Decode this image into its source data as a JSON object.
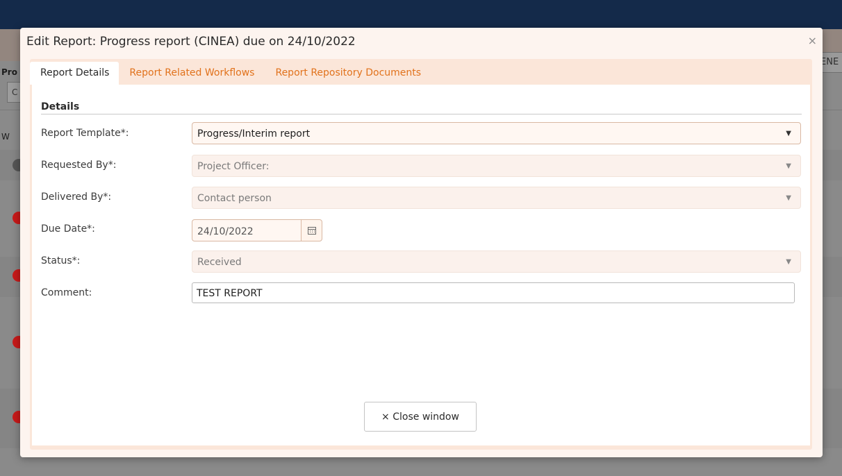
{
  "background": {
    "header_button_fragment": "ENE",
    "left_label_1": "Pro",
    "left_box_char": "C",
    "left_label_2": "W"
  },
  "modal": {
    "title": "Edit Report: Progress report (CINEA) due on 24/10/2022",
    "close_icon": "×"
  },
  "tabs": [
    {
      "label": "Report Details",
      "active": true
    },
    {
      "label": "Report Related Workflows",
      "active": false
    },
    {
      "label": "Report Repository Documents",
      "active": false
    }
  ],
  "details": {
    "section_title": "Details",
    "report_template": {
      "label": "Report Template*:",
      "value": "Progress/Interim report"
    },
    "requested_by": {
      "label": "Requested By*:",
      "value": "Project Officer:"
    },
    "delivered_by": {
      "label": "Delivered By*:",
      "value": "Contact person"
    },
    "due_date": {
      "label": "Due Date*:",
      "value": "24/10/2022"
    },
    "status": {
      "label": "Status*:",
      "value": "Received"
    },
    "comment": {
      "label": "Comment:",
      "value": "TEST REPORT"
    }
  },
  "close_button": {
    "label": "× Close window"
  },
  "colors": {
    "accent_tab_text": "#e1721c",
    "modal_bg": "#fdf4ef",
    "tab_area_bg": "#fbe6d9",
    "header_bar": "#142a4a"
  }
}
